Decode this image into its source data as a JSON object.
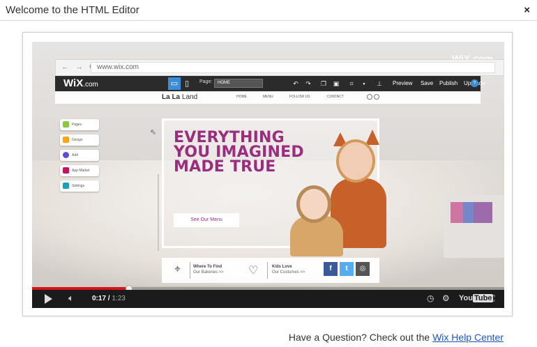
{
  "dialog": {
    "title": "Welcome to the HTML Editor",
    "close_glyph": "×"
  },
  "video": {
    "corner_logo": "WiX.com",
    "browser": {
      "nav_glyphs": "← → C",
      "url": "www.wix.com"
    },
    "editor_bar": {
      "brand": "WiX",
      "brand_suffix": ".com",
      "page_label": "Page:",
      "page_value": "HOME",
      "menu": [
        "Preview",
        "Save",
        "Publish",
        "Upgrade"
      ],
      "help_glyph": "?"
    },
    "site": {
      "logo_bold": "La La",
      "logo_light": " Land",
      "nav": [
        "HOME",
        "MENU",
        "FOLLOW US",
        "CONTACT"
      ]
    },
    "panel": [
      {
        "label": "Pages",
        "color": "#8dc63f"
      },
      {
        "label": "Design",
        "color": "#f7a51c"
      },
      {
        "label": "Add",
        "color": "#5a4fcf"
      },
      {
        "label": "App Market",
        "color": "#c4145c"
      },
      {
        "label": "Settings",
        "color": "#21a1b5"
      }
    ],
    "hero": {
      "headline": "EVERYTHING YOU IMAGINED MADE TRUE",
      "cta": "See Our Menu"
    },
    "strip": {
      "item1_line1": "Where To Find",
      "item1_line2": "Our Bakeries >>",
      "item2_line1": "Kids Love",
      "item2_line2": "Our Costumes >>",
      "social": [
        {
          "glyph": "f",
          "color": "#3b5998"
        },
        {
          "glyph": "t",
          "color": "#55acee"
        },
        {
          "glyph": "◎",
          "color": "#555555"
        }
      ]
    },
    "controls": {
      "current_time": "0:17",
      "duration": "1:23",
      "progress": 0.205,
      "youtube_you": "You",
      "youtube_tube": "Tube"
    }
  },
  "footer": {
    "question": "Have a Question? Check out the ",
    "link": "Wix Help Center"
  }
}
